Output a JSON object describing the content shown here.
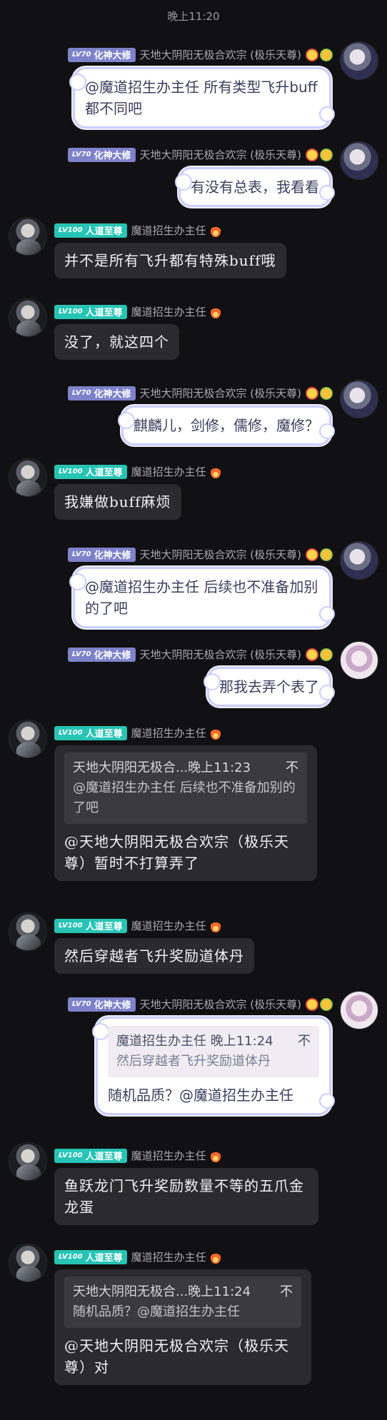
{
  "time_separator": "晚上11:20",
  "users": {
    "me": {
      "level": "LV70",
      "rank": "化神大修",
      "name": "天地大阴阳无极合欢宗 (极乐天尊)"
    },
    "master": {
      "level": "LV100",
      "rank": "人道至尊",
      "name": "魔道招生办主任"
    }
  },
  "messages": [
    {
      "text": "@魔道招生办主任 所有类型飞升buff都不同吧"
    },
    {
      "text": "有没有总表，我看看"
    },
    {
      "text": "并不是所有飞升都有特殊buff哦"
    },
    {
      "text": "没了，就这四个"
    },
    {
      "text": "麒麟儿，剑修，儒修，魔修？"
    },
    {
      "text": "我嫌做buff麻烦"
    },
    {
      "text": "@魔道招生办主任 后续也不准备加别的了吧"
    },
    {
      "text": "那我去弄个表了"
    },
    {
      "quote_head": "天地大阴阳无极合...晚上11:23",
      "quote_close": "不",
      "quote_text": "@魔道招生办主任 后续也不准备加别的了吧",
      "text": "@天地大阴阳无极合欢宗（极乐天尊）暂时不打算弄了"
    },
    {
      "text": "然后穿越者飞升奖励道体丹"
    },
    {
      "quote_head": "魔道招生办主任 晚上11:24",
      "quote_close": "不",
      "quote_text": "然后穿越者飞升奖励道体丹",
      "text": "随机品质？@魔道招生办主任"
    },
    {
      "text": "鱼跃龙门飞升奖励数量不等的五爪金龙蛋"
    },
    {
      "quote_head": "天地大阴阳无极合...晚上11:24",
      "quote_close": "不",
      "quote_text": "随机品质？@魔道招生办主任",
      "text": "@天地大阴阳无极合欢宗（极乐天尊）对"
    }
  ]
}
